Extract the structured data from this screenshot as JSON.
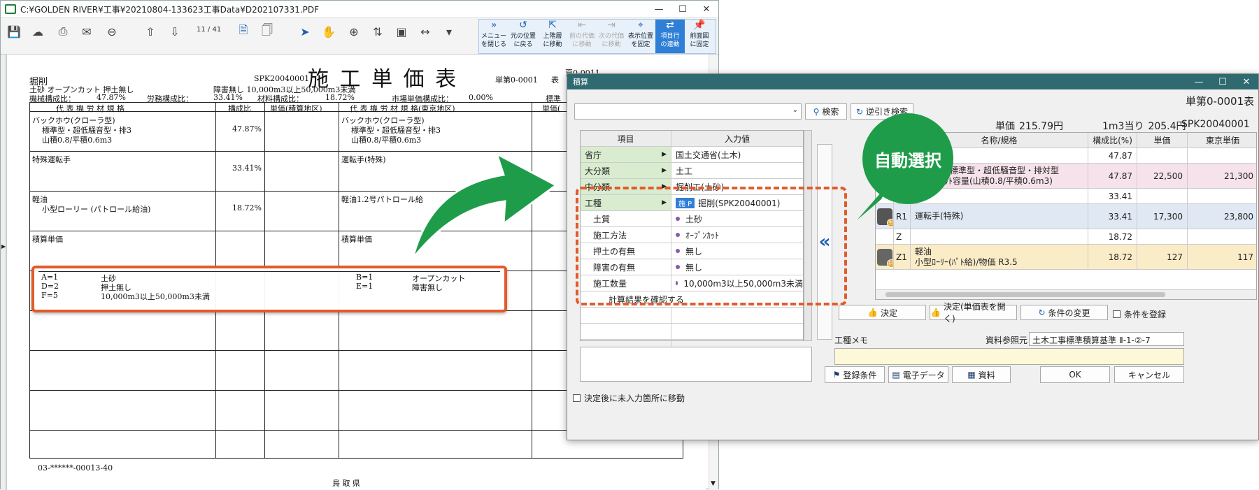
{
  "pdf": {
    "title": "C:¥GOLDEN RIVER¥工事¥20210804-133623工事Data¥D202107331.PDF",
    "page_current": "11",
    "page_total": "/ 41",
    "toolbar_group": [
      {
        "l1": "メニュー",
        "l2": "を閉じる",
        "icon": "»",
        "state": ""
      },
      {
        "l1": "元の位置",
        "l2": "に戻る",
        "icon": "↺",
        "state": ""
      },
      {
        "l1": "上階層",
        "l2": "に移動",
        "icon": "⇱",
        "state": ""
      },
      {
        "l1": "前の代価",
        "l2": "に移動",
        "icon": "⇤",
        "state": "dis"
      },
      {
        "l1": "次の代価",
        "l2": "に移動",
        "icon": "⇥",
        "state": "dis"
      },
      {
        "l1": "表示位置",
        "l2": "を固定",
        "icon": "⌖",
        "state": ""
      },
      {
        "l1": "項目行",
        "l2": "の連動",
        "icon": "⇄",
        "state": "on"
      },
      {
        "l1": "前面図",
        "l2": "に固定",
        "icon": "📌",
        "state": ""
      }
    ],
    "doc": {
      "heading": "施 工 単 価 表",
      "category": "掘削",
      "code": "SPK20040001",
      "sheet_no": "単第0-0001",
      "sheet_unit": "表",
      "page_label": "頁0-0011",
      "line1a": "土砂 オープンカット 押土無し",
      "line1b": "障害無し 10,000m3以上50,000m3未満",
      "ratio_machine": "機械構成比：",
      "ratio_machine_v": "47.87%",
      "ratio_labor": "労務構成比：",
      "ratio_labor_v": "33.41%",
      "ratio_material": "材料構成比：",
      "ratio_material_v": "18.72%",
      "ratio_market": "市場単価構成比：",
      "ratio_market_v": "0.00%",
      "ratio_std": "標準",
      "col_spec": "代 表 機 労 材 規 格",
      "col_ratio": "構成比",
      "col_unit_area": "単価(積算地区)",
      "col_spec_tokyo": "代 表 機 労 材 規 格(東京地区)",
      "col_unit_tokyo": "単価(",
      "r1_name": "バックホウ(クローラ型)",
      "r1_sub1": "標準型・超低騒音型・排3",
      "r1_sub2": "山積0.8/平積0.6m3",
      "r1_ratio": "47.87%",
      "r1t_name": "バックホウ(クローラ型)",
      "r1t_sub1": "標準型・超低騒音型・排3",
      "r1t_sub2": "山積0.8/平積0.6m3",
      "r2_name": "特殊運転手",
      "r2_ratio": "33.41%",
      "r2t_name": "運転手(特殊)",
      "r3_name": "軽油",
      "r3_sub": "小型ローリー (パトロール給油)",
      "r3_ratio": "18.72%",
      "r3t_name": "軽油1.2号パトロール給",
      "r4_name": "積算単価",
      "r4t_name": "積算単価",
      "a1k": "A=1",
      "a1v": "土砂",
      "a2k": "D=2",
      "a2v": "押土無し",
      "a3k": "F=5",
      "a3v": "10,000m3以上50,000m3未満",
      "b1k": "B=1",
      "b1v": "オープンカット",
      "b2k": "E=1",
      "b2v": "障害無し",
      "footer_code": "03-******-00013-40",
      "footer_pref": "鳥 取 県"
    }
  },
  "dialog": {
    "title": "積算",
    "search_label": "検索",
    "reverse_label": "逆引き検索",
    "left_table": {
      "col_item": "項目",
      "col_value": "入力値",
      "rows": [
        {
          "item": "省庁",
          "value": "国土交通省(土木)",
          "kind": "green"
        },
        {
          "item": "大分類",
          "value": "土工",
          "kind": "green"
        },
        {
          "item": "中分類",
          "value": "掘削工(土砂)",
          "kind": "green"
        },
        {
          "item": "工種",
          "value": "掘削(SPK20040001)",
          "kind": "green",
          "badge": "施 P"
        },
        {
          "item": "土質",
          "value": "土砂",
          "kind": "dot"
        },
        {
          "item": "施工方法",
          "value": "ｵｰﾌﾟﾝｶｯﾄ",
          "kind": "dot"
        },
        {
          "item": "押土の有無",
          "value": "無し",
          "kind": "dot"
        },
        {
          "item": "障害の有無",
          "value": "無し",
          "kind": "dot"
        },
        {
          "item": "施工数量",
          "value": "10,000m3以上50,000m3未満",
          "kind": "dot"
        },
        {
          "item": "計算結果を確認する",
          "value": "",
          "kind": "plain"
        }
      ]
    },
    "chk_move": "決定後に未入力箇所に移動",
    "chevron": "«",
    "right": {
      "sheet_title": "単第0-0001表",
      "unit_price_label": "単価",
      "unit_price": "215.79円",
      "per_m3_label": "1m3当り",
      "per_m3": "205.4円",
      "code": "SPK20040001",
      "cols": {
        "name": "名称/規格",
        "ratio": "構成比(%)",
        "unit": "単価",
        "tokyo": "東京単価"
      },
      "rows": [
        {
          "code": "",
          "name": "",
          "sub": "",
          "ratio": "47.87",
          "unit": "",
          "tokyo": "",
          "bg": "#ffffff"
        },
        {
          "code": "",
          "name": "(ｸﾛｰﾗ型)[標準型・超低騒音型・排対型",
          "sub": "標準ﾊﾞｹｯﾄ容量(山積0.8/平積0.6m3)",
          "ratio": "47.87",
          "unit": "22,500",
          "tokyo": "21,300",
          "bg": "#f6e2ea"
        },
        {
          "code": "R",
          "name": "",
          "sub": "",
          "ratio": "33.41",
          "unit": "",
          "tokyo": "",
          "bg": "#ffffff"
        },
        {
          "code": "R1",
          "name": "運転手(特殊)",
          "sub": "",
          "ratio": "33.41",
          "unit": "17,300",
          "tokyo": "23,800",
          "bg": "#e0e8f4"
        },
        {
          "code": "Z",
          "name": "",
          "sub": "",
          "ratio": "18.72",
          "unit": "",
          "tokyo": "",
          "bg": "#ffffff"
        },
        {
          "code": "Z1",
          "name": "軽油",
          "sub": "小型ﾛｰﾘｰ(ﾊﾟﾄ給)/物価 R3.5",
          "ratio": "18.72",
          "unit": "127",
          "tokyo": "117",
          "bg": "#fbecc8"
        }
      ],
      "avatar_badges": [
        "労",
        "材"
      ],
      "btn_decide": "決定",
      "btn_decide_open": "決定(単価表を開く)",
      "btn_change": "条件の変更",
      "chk_register": "条件を登録",
      "memo_label": "工種メモ",
      "ref_label": "資料参照元",
      "ref_value": "土木工事標準積算基準 Ⅱ-1-②-7"
    },
    "bottom": {
      "btn_reg": "登録条件",
      "btn_edata": "電子データ",
      "btn_doc": "資料",
      "btn_ok": "OK",
      "btn_cancel": "キャンセル"
    },
    "bubble": "自動選択"
  },
  "colors": {
    "accent_orange": "#e25b2a",
    "bubble_green": "#1e9c4a",
    "title_teal": "#2f6a70",
    "selected_blue": "#2f7fd6"
  }
}
